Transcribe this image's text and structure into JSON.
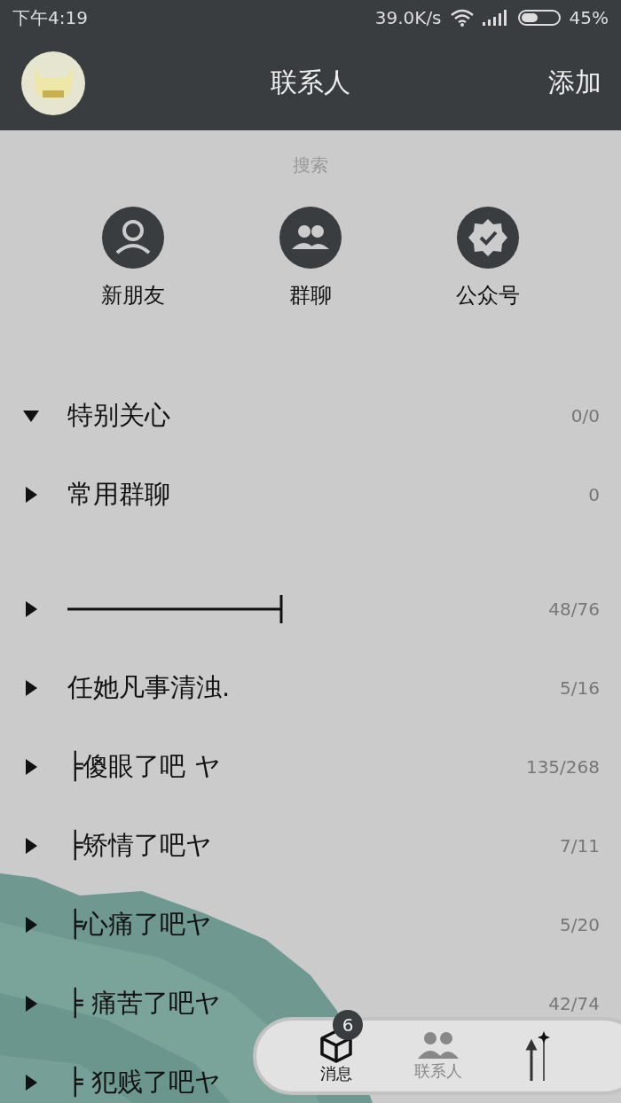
{
  "status_bar": {
    "time": "下午4:19",
    "speed": "39.0K/s",
    "battery": "45%"
  },
  "header": {
    "title": "联系人",
    "action": "添加"
  },
  "search": {
    "placeholder": "搜索"
  },
  "shortcuts": [
    {
      "kind": "person",
      "label": "新朋友"
    },
    {
      "kind": "group",
      "label": "群聊"
    },
    {
      "kind": "badge",
      "label": "公众号"
    }
  ],
  "groups": [
    {
      "name": "特别关心",
      "count": "0/0",
      "expanded": true,
      "kind": "text"
    },
    {
      "name": "常用群聊",
      "count": "0",
      "expanded": false,
      "kind": "text"
    },
    {
      "count": "48/76",
      "expanded": false,
      "kind": "line"
    },
    {
      "name": "任她凡事清浊.",
      "count": "5/16",
      "expanded": false,
      "kind": "text"
    },
    {
      "name": "╞傻眼了吧 ヤ",
      "count": "135/268",
      "expanded": false,
      "kind": "text"
    },
    {
      "name": "╞矫情了吧ヤ",
      "count": "7/11",
      "expanded": false,
      "kind": "text"
    },
    {
      "name": "╞心痛了吧ヤ",
      "count": "5/20",
      "expanded": false,
      "kind": "text"
    },
    {
      "name": "╞ 痛苦了吧ヤ",
      "count": "42/74",
      "expanded": false,
      "kind": "text"
    },
    {
      "name": "╞ 犯贱了吧ヤ",
      "expanded": false,
      "kind": "text"
    }
  ],
  "bottom_nav": [
    {
      "kind": "box",
      "label": "消息",
      "badge": "6",
      "selected": true
    },
    {
      "kind": "people",
      "label": "联系人",
      "selected": false
    },
    {
      "kind": "arrows",
      "selected": false
    }
  ]
}
